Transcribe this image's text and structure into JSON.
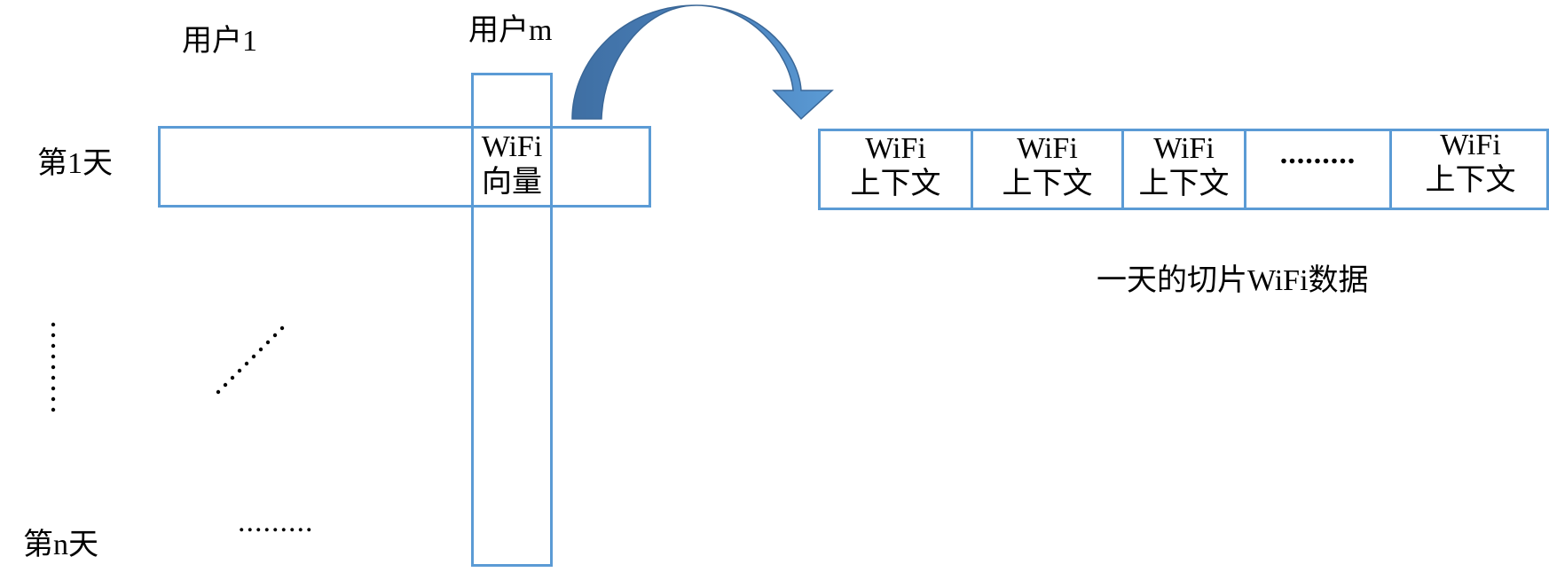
{
  "labels": {
    "user_first": "用户1",
    "user_last": "用户m",
    "day_first": "第1天",
    "day_last": "第n天",
    "matrix_cell": [
      "WiFi",
      "向量"
    ],
    "caption": "一天的切片WiFi数据"
  },
  "sequence": {
    "cells": [
      [
        "WiFi",
        "上下文"
      ],
      [
        "WiFi",
        "上下文"
      ],
      [
        "WiFi",
        "上下文"
      ],
      [
        ".........",
        ""
      ],
      [
        "WiFi",
        "上下文"
      ]
    ]
  },
  "ellipsis": {
    "horizontal": "........."
  },
  "colors": {
    "box_border": "#5b9bd5",
    "arrow_light": "#5b9bd5",
    "arrow_dark": "#3f6fa3"
  }
}
